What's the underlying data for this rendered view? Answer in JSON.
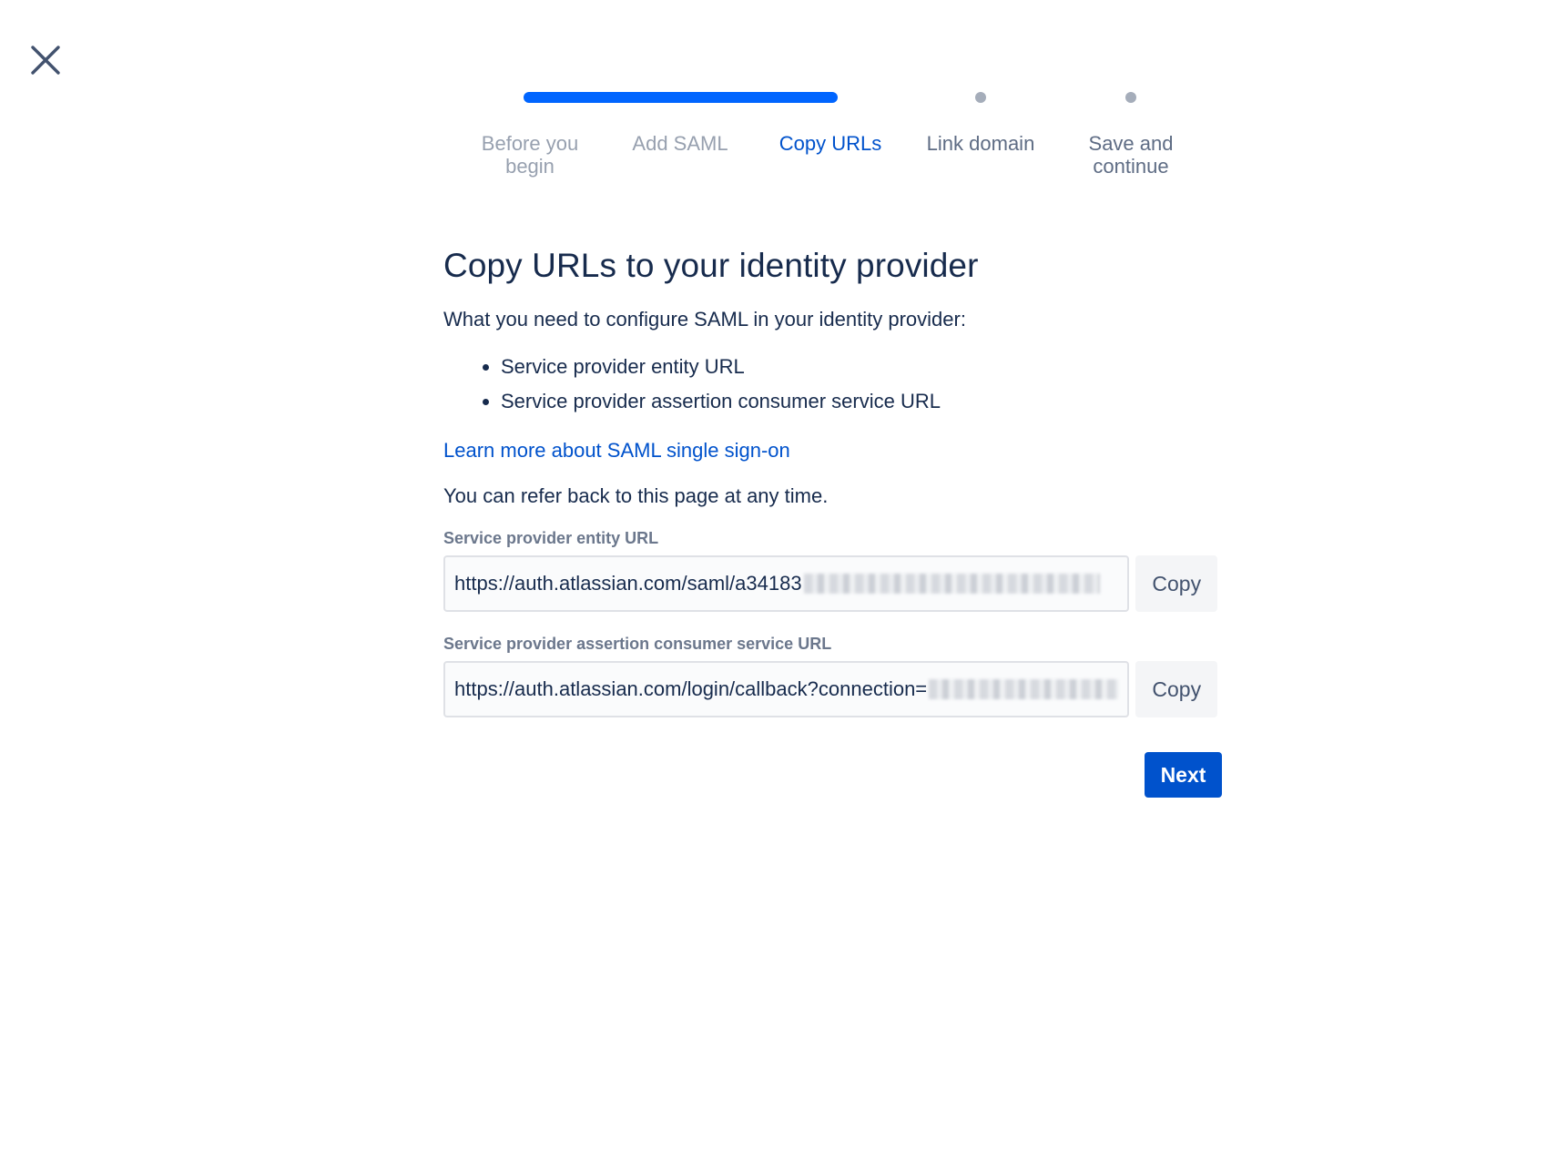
{
  "close": {
    "icon": "close-icon"
  },
  "progress": {
    "steps": [
      {
        "label_line1": "Before you",
        "label_line2": "begin",
        "state": "done"
      },
      {
        "label_line1": "Add SAML",
        "label_line2": "",
        "state": "done"
      },
      {
        "label_line1": "Copy URLs",
        "label_line2": "",
        "state": "current"
      },
      {
        "label_line1": "Link domain",
        "label_line2": "",
        "state": "upcoming"
      },
      {
        "label_line1": "Save and",
        "label_line2": "continue",
        "state": "upcoming"
      }
    ],
    "colors": {
      "active": "#0065ff",
      "inactive": "#a5adba",
      "current_label": "#0052cc"
    }
  },
  "main": {
    "title": "Copy URLs to your identity provider",
    "intro": "What you need to configure SAML in your identity provider:",
    "requirements": [
      "Service provider entity URL",
      "Service provider assertion consumer service URL"
    ],
    "learn_link": "Learn more about SAML single sign-on",
    "refer_note": "You can refer back to this page at any time.",
    "fields": [
      {
        "label": "Service provider entity URL",
        "value_visible": "https://auth.atlassian.com/saml/a34183",
        "value_redacted": true,
        "copy_label": "Copy"
      },
      {
        "label": "Service provider assertion consumer service URL",
        "value_visible": "https://auth.atlassian.com/login/callback?connection=",
        "value_redacted": true,
        "copy_label": "Copy"
      }
    ],
    "next_label": "Next"
  }
}
